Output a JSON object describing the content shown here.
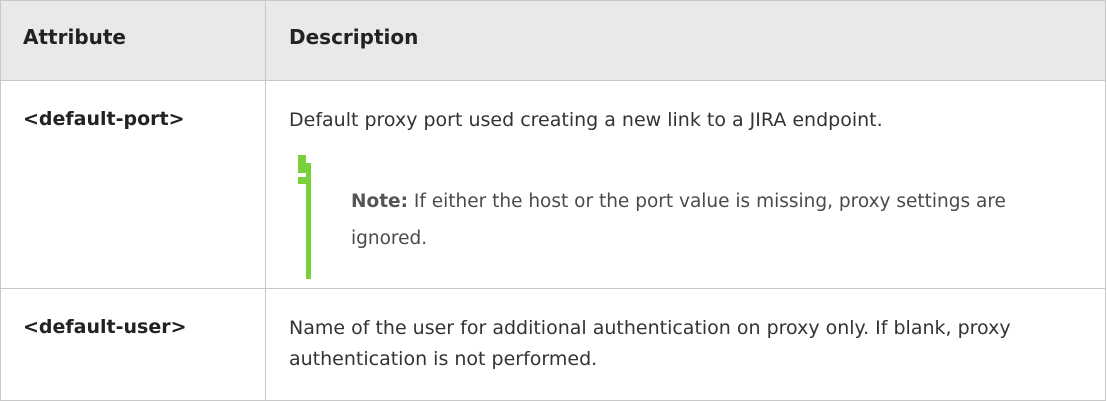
{
  "table": {
    "headers": {
      "attribute": "Attribute",
      "description": "Description"
    },
    "rows": [
      {
        "attribute": "<default-port>",
        "description": "Default proxy port used creating a new link to a JIRA endpoint.",
        "note": {
          "label": "Note:",
          "text": "If either the host or the port value is missing, proxy settings are ignored.",
          "icon": "exclamation-icon",
          "accent_color": "#7ad03a"
        }
      },
      {
        "attribute": "<default-user>",
        "description": "Name of the user for additional authentication on proxy only. If blank, proxy authentication is not performed."
      }
    ]
  }
}
